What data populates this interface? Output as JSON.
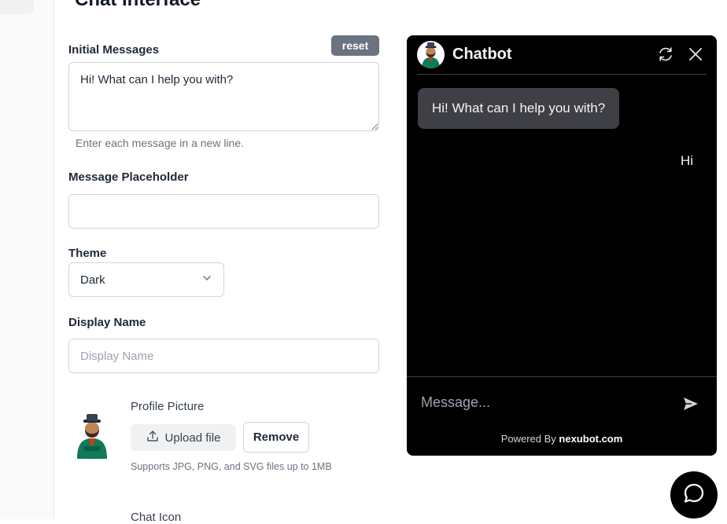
{
  "page": {
    "title": "Chat Interface"
  },
  "form": {
    "initial_messages": {
      "label": "Initial Messages",
      "reset_label": "reset",
      "value": "Hi! What can I help you with?",
      "hint": "Enter each message in a new line."
    },
    "message_placeholder": {
      "label": "Message Placeholder",
      "value": ""
    },
    "theme": {
      "label": "Theme",
      "selected": "Dark"
    },
    "display_name": {
      "label": "Display Name",
      "placeholder": "Display Name",
      "value": ""
    },
    "profile_picture": {
      "label": "Profile Picture",
      "upload_label": "Upload file",
      "remove_label": "Remove",
      "hint": "Supports JPG, PNG, and SVG files up to 1MB"
    },
    "chat_icon": {
      "label": "Chat Icon"
    }
  },
  "preview": {
    "title": "Chatbot",
    "bot_message": "Hi! What can I help you with?",
    "user_message": "Hi",
    "input_placeholder": "Message...",
    "powered_prefix": "Powered By",
    "powered_brand": "nexubot.com",
    "background_color": "#000000",
    "bubble_color": "#3f3f46"
  },
  "icons": {
    "refresh": "refresh-icon",
    "close": "close-icon",
    "send": "send-icon",
    "upload": "upload-icon",
    "chevron": "chevron-down-icon",
    "chat_bubble": "chat-bubble-icon"
  }
}
